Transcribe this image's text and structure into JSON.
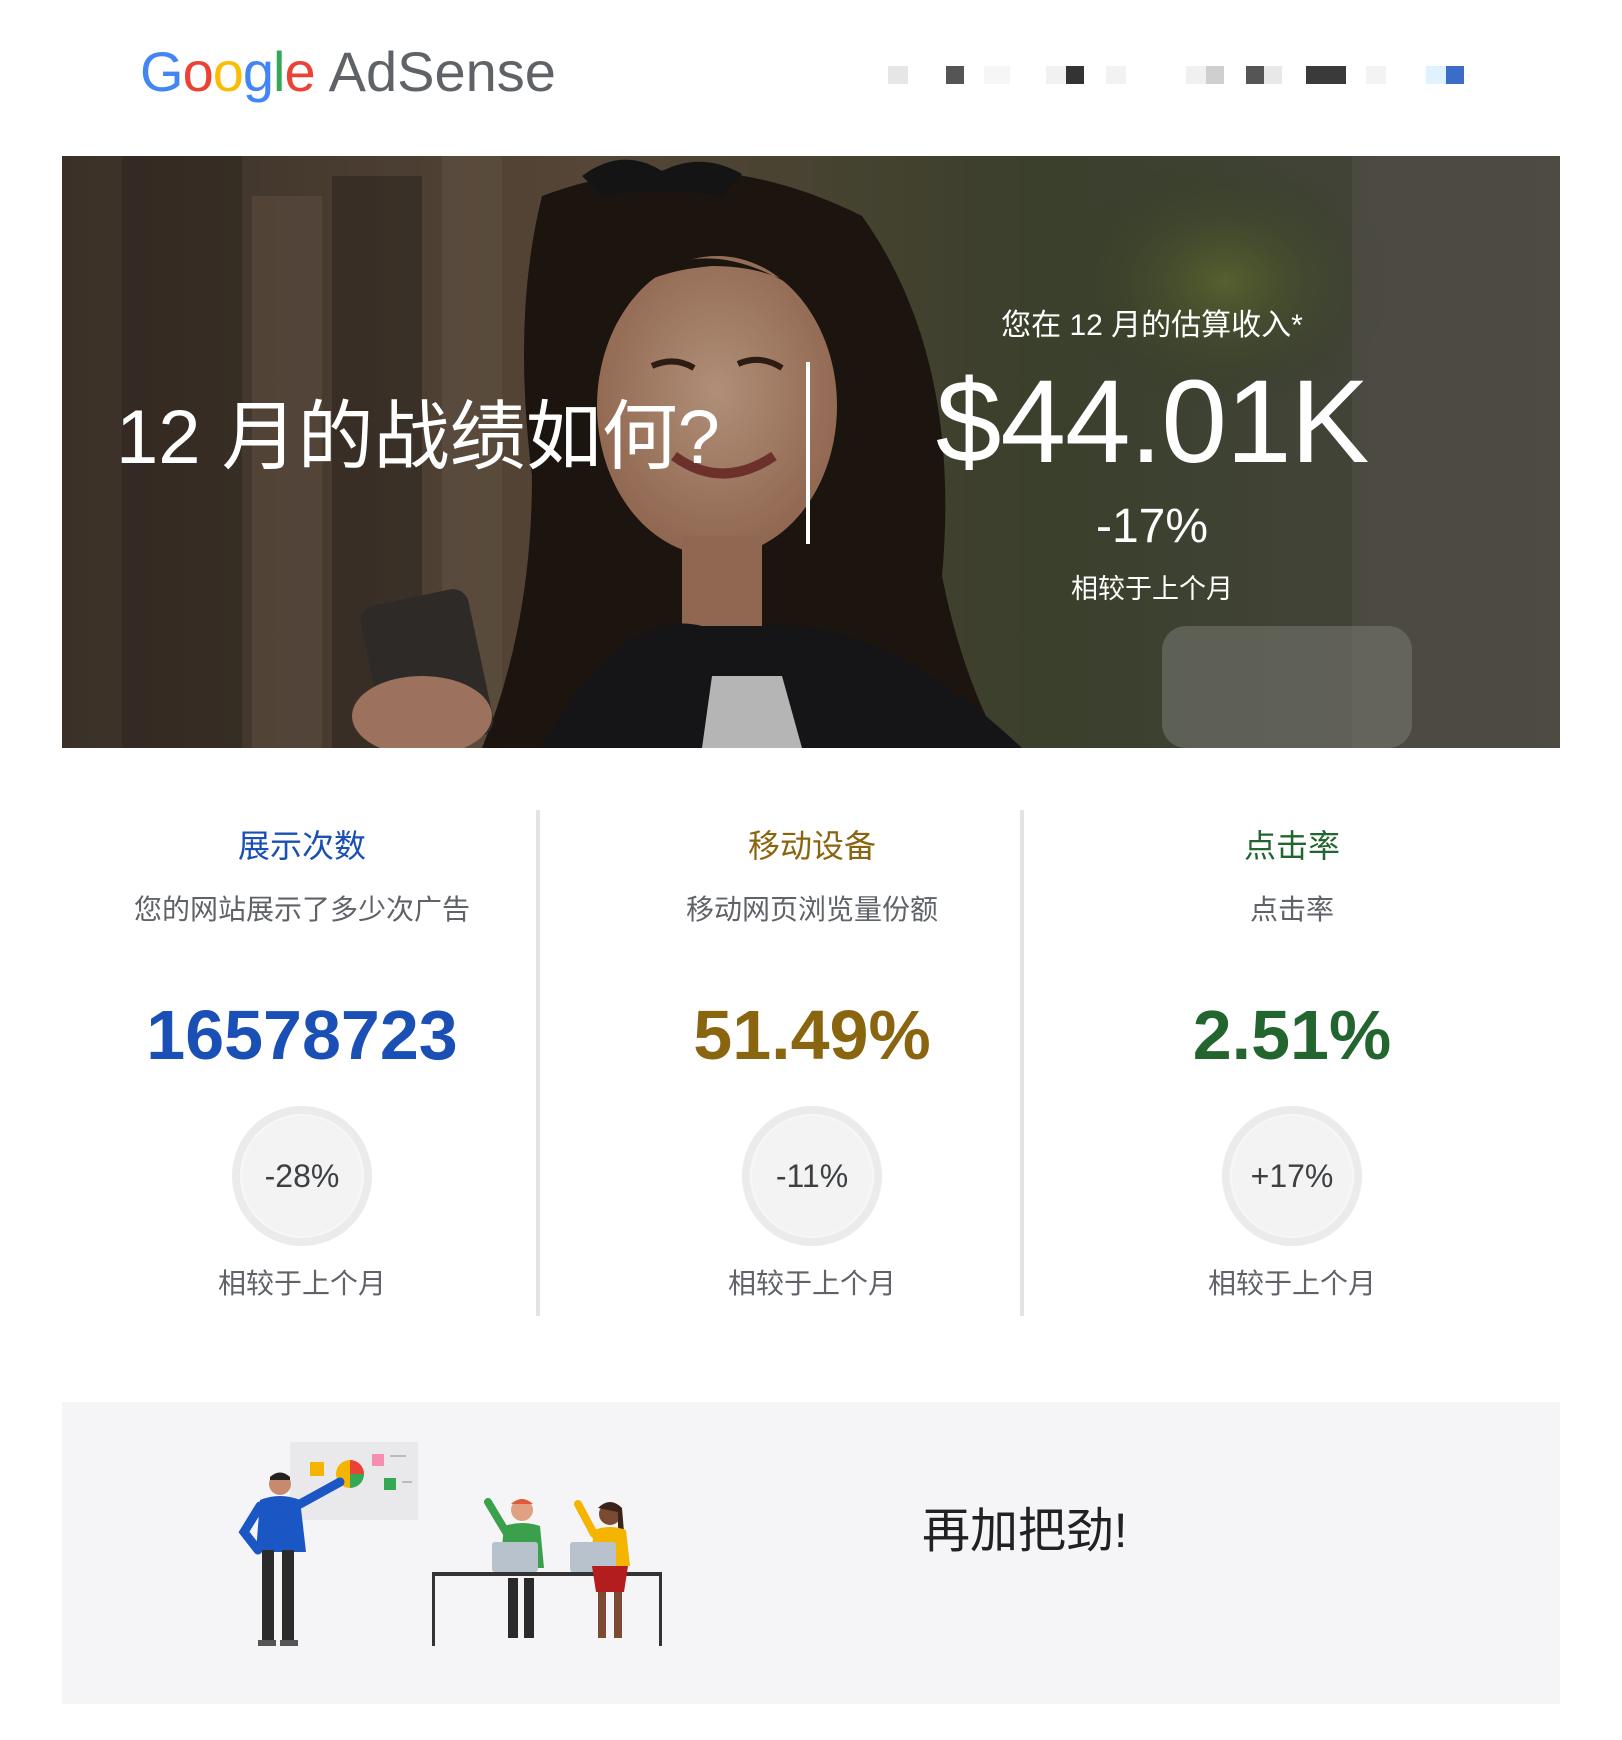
{
  "header": {
    "logo": {
      "g1": "G",
      "o1": "o",
      "o2": "o",
      "g2": "g",
      "l": "l",
      "e": "e",
      "product": "AdSense"
    }
  },
  "hero": {
    "title": "12 月的战绩如何?",
    "earnings_label": "您在 12 月的估算收入*",
    "earnings_value": "$44.01K",
    "earnings_change": "-17%",
    "earnings_compare": "相较于上个月"
  },
  "stats": [
    {
      "title": "展示次数",
      "desc": "您的网站展示了多少次广告",
      "value": "16578723",
      "change": "-28%",
      "compare": "相较于上个月",
      "color": "#1a4fb5"
    },
    {
      "title": "移动设备",
      "desc": "移动网页浏览量份额",
      "value": "51.49%",
      "change": "-11%",
      "compare": "相较于上个月",
      "color": "#8a6510"
    },
    {
      "title": "点击率",
      "desc": "点击率",
      "value": "2.51%",
      "change": "+17%",
      "compare": "相较于上个月",
      "color": "#22652f"
    }
  ],
  "footer": {
    "message": "再加把劲!"
  }
}
